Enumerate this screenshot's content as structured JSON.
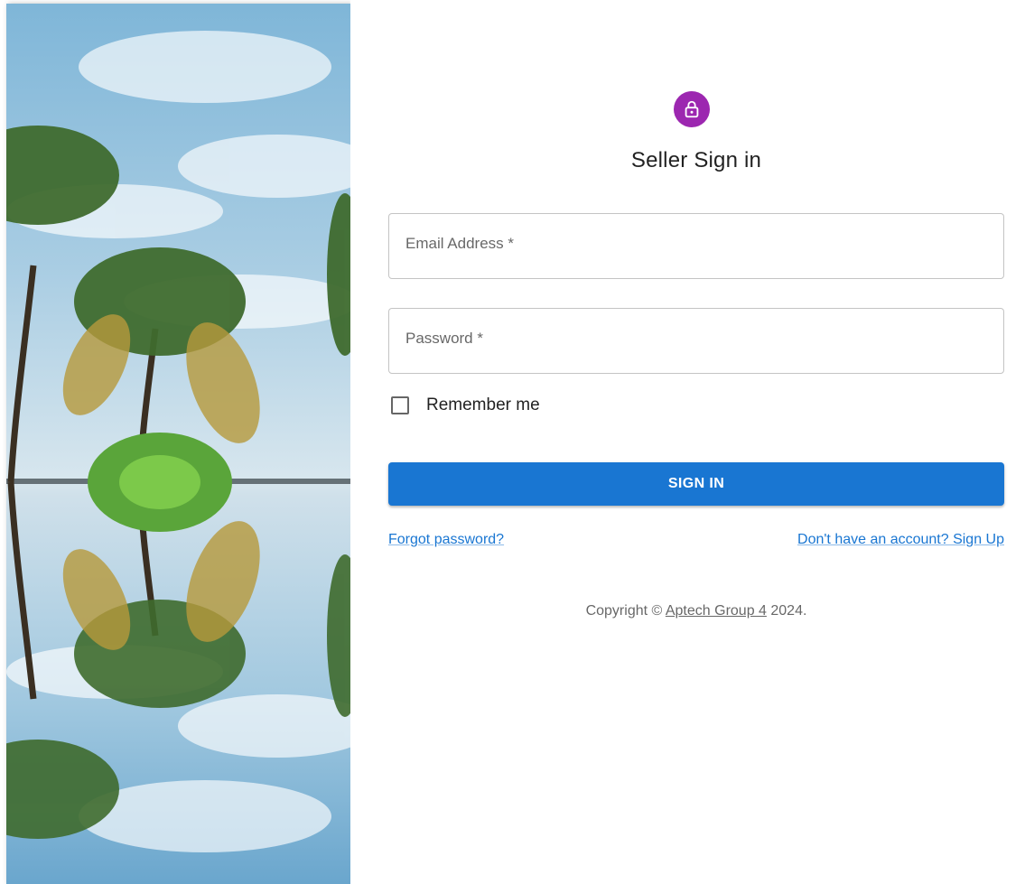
{
  "hero": {
    "image": "tropical-palm-trees-reflection"
  },
  "form": {
    "avatar_icon": "lock-icon",
    "title": "Seller Sign in",
    "email": {
      "label": "Email Address *",
      "value": ""
    },
    "password": {
      "label": "Password *",
      "value": ""
    },
    "remember": {
      "label": "Remember me",
      "checked": false
    },
    "submit_label": "SIGN IN",
    "forgot_link": "Forgot password?",
    "signup_link": "Don't have an account? Sign Up"
  },
  "footer": {
    "prefix": "Copyright © ",
    "link": "Aptech Group 4",
    "suffix": " 2024."
  },
  "colors": {
    "avatar": "#9c27b0",
    "primary": "#1976d2"
  }
}
